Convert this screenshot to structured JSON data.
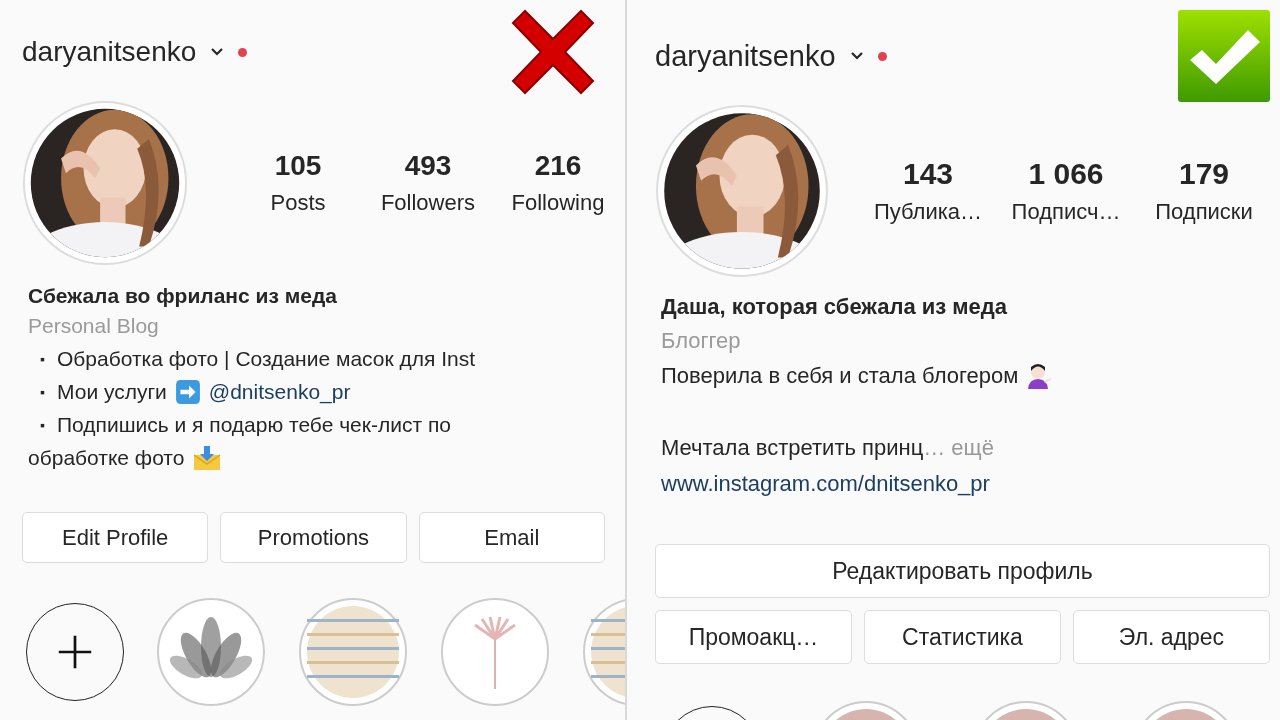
{
  "panels": [
    {
      "kind": "rejected",
      "username": "daryanitsenko",
      "notification_dot": true,
      "stats": [
        {
          "value": "105",
          "label": "Posts"
        },
        {
          "value": "493",
          "label": "Followers"
        },
        {
          "value": "216",
          "label": "Following"
        }
      ],
      "name": "Сбежала во фриланс из меда",
      "category": "Personal Blog",
      "bio": [
        {
          "kind": "line",
          "parts": [
            {
              "kind": "bullet",
              "text": "▪"
            },
            {
              "kind": "text",
              "text": "Обработка фото | Создание масок для Inst"
            }
          ]
        },
        {
          "kind": "line",
          "parts": [
            {
              "kind": "bullet",
              "text": "▪"
            },
            {
              "kind": "text",
              "text": "Мои услуги"
            },
            {
              "kind": "arrow-emoji"
            },
            {
              "kind": "link",
              "text": "@dnitsenko_pr"
            }
          ]
        },
        {
          "kind": "line",
          "parts": [
            {
              "kind": "bullet",
              "text": "▪"
            },
            {
              "kind": "text",
              "text": "Подпишись и я подарю тебе чек-лист по"
            }
          ]
        },
        {
          "kind": "line",
          "parts": [
            {
              "kind": "text",
              "text": "обработке фото"
            },
            {
              "kind": "envelope-emoji"
            }
          ]
        }
      ],
      "button_rows": [
        {
          "buttons": [
            "Edit Profile",
            "Promotions",
            "Email"
          ]
        }
      ],
      "highlights": [
        {
          "kind": "new"
        },
        {
          "kind": "flower"
        },
        {
          "kind": "stripes"
        },
        {
          "kind": "dandelion"
        },
        {
          "kind": "stripes"
        }
      ]
    },
    {
      "kind": "approved",
      "username": "daryanitsenko",
      "notification_dot": true,
      "stats": [
        {
          "value": "143",
          "label": "Публика…"
        },
        {
          "value": "1 066",
          "label": "Подписч…"
        },
        {
          "value": "179",
          "label": "Подписки"
        }
      ],
      "name": "Даша, которая сбежала из меда",
      "category": "Блоггер",
      "bio": [
        {
          "kind": "line",
          "parts": [
            {
              "kind": "text",
              "text": "Поверила в себя и стала блогером"
            },
            {
              "kind": "person-emoji"
            }
          ]
        },
        {
          "kind": "blank"
        },
        {
          "kind": "line",
          "parts": [
            {
              "kind": "text",
              "text": "Мечтала встретить принц"
            },
            {
              "kind": "more",
              "text": "… ещё"
            }
          ]
        },
        {
          "kind": "line",
          "parts": [
            {
              "kind": "link",
              "text": "www.instagram.com/dnitsenko_pr"
            }
          ]
        }
      ],
      "button_rows": [
        {
          "buttons": [
            "Редактировать профиль"
          ]
        },
        {
          "buttons": [
            "Промоакц…",
            "Статистика",
            "Эл. адрес"
          ]
        }
      ],
      "highlights": [
        {
          "kind": "ring"
        },
        {
          "kind": "blush"
        },
        {
          "kind": "blush"
        },
        {
          "kind": "blush"
        }
      ]
    }
  ]
}
